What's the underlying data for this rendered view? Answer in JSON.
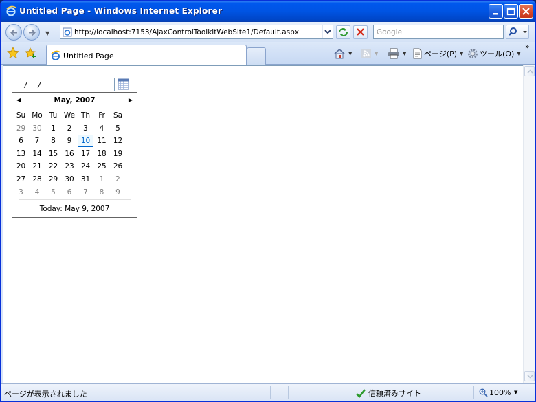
{
  "window": {
    "title": "Untitled Page - Windows Internet Explorer"
  },
  "navbar": {
    "url": "http://localhost:7153/AjaxControlToolkitWebSite1/Default.aspx",
    "search_placeholder": "Google"
  },
  "tabs": [
    {
      "label": "Untitled Page"
    }
  ],
  "commands": {
    "page_label": "ページ(P)",
    "tools_label": "ツール(O)"
  },
  "date_input": {
    "value": "__/__/____"
  },
  "calendar": {
    "title": "May, 2007",
    "day_headers": [
      "Su",
      "Mo",
      "Tu",
      "We",
      "Th",
      "Fr",
      "Sa"
    ],
    "weeks": [
      [
        {
          "d": "29",
          "other": true
        },
        {
          "d": "30",
          "other": true
        },
        {
          "d": "1"
        },
        {
          "d": "2"
        },
        {
          "d": "3"
        },
        {
          "d": "4"
        },
        {
          "d": "5"
        }
      ],
      [
        {
          "d": "6"
        },
        {
          "d": "7"
        },
        {
          "d": "8"
        },
        {
          "d": "9"
        },
        {
          "d": "10",
          "selected": true
        },
        {
          "d": "11"
        },
        {
          "d": "12"
        }
      ],
      [
        {
          "d": "13"
        },
        {
          "d": "14"
        },
        {
          "d": "15"
        },
        {
          "d": "16"
        },
        {
          "d": "17"
        },
        {
          "d": "18"
        },
        {
          "d": "19"
        }
      ],
      [
        {
          "d": "20"
        },
        {
          "d": "21"
        },
        {
          "d": "22"
        },
        {
          "d": "23"
        },
        {
          "d": "24"
        },
        {
          "d": "25"
        },
        {
          "d": "26"
        }
      ],
      [
        {
          "d": "27"
        },
        {
          "d": "28"
        },
        {
          "d": "29"
        },
        {
          "d": "30"
        },
        {
          "d": "31"
        },
        {
          "d": "1",
          "other": true
        },
        {
          "d": "2",
          "other": true
        }
      ],
      [
        {
          "d": "3",
          "other": true
        },
        {
          "d": "4",
          "other": true
        },
        {
          "d": "5",
          "other": true
        },
        {
          "d": "6",
          "other": true
        },
        {
          "d": "7",
          "other": true
        },
        {
          "d": "8",
          "other": true
        },
        {
          "d": "9",
          "other": true
        }
      ]
    ],
    "today_label": "Today: May 9, 2007"
  },
  "statusbar": {
    "status_text": "ページが表示されました",
    "zone_text": "信頼済みサイト",
    "zoom_text": "100%"
  },
  "colors": {
    "titlebar": "#0054e3",
    "selected_day": "#0066cc"
  }
}
